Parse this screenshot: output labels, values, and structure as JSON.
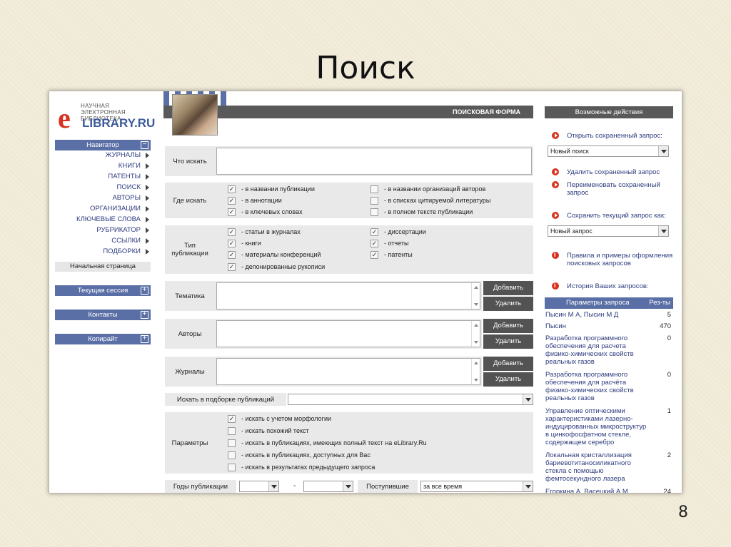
{
  "slide": {
    "title": "Поиск",
    "page_number": "8"
  },
  "logo": {
    "tagline": "НАУЧНАЯ ЭЛЕКТРОННАЯ БИБЛИОТЕКА",
    "letter": "e",
    "name": "LIBRARY.RU"
  },
  "sidebar": {
    "navigator_label": "Навигатор",
    "items": [
      "ЖУРНАЛЫ",
      "КНИГИ",
      "ПАТЕНТЫ",
      "ПОИСК",
      "АВТОРЫ",
      "ОРГАНИЗАЦИИ",
      "КЛЮЧЕВЫЕ СЛОВА",
      "РУБРИКАТОР",
      "ССЫЛКИ",
      "ПОДБОРКИ"
    ],
    "home": "Начальная страница",
    "session": "Текущая сессия",
    "contacts": "Контакты",
    "copyright": "Копирайт"
  },
  "form": {
    "header": "ПОИСКОВАЯ ФОРМА",
    "what_label": "Что искать",
    "where_label": "Где искать",
    "where_options": [
      {
        "label": "- в названии публикации",
        "checked": true
      },
      {
        "label": "- в аннотации",
        "checked": true
      },
      {
        "label": "- в ключевых словах",
        "checked": true
      },
      {
        "label": "- в названии организаций авторов",
        "checked": false
      },
      {
        "label": "- в списках цитируемой литературы",
        "checked": false
      },
      {
        "label": "- в полном тексте публикации",
        "checked": false
      }
    ],
    "type_label": "Тип публикации",
    "type_options": [
      {
        "label": "- статьи в журналах",
        "checked": true
      },
      {
        "label": "- книги",
        "checked": true
      },
      {
        "label": "- материалы конференций",
        "checked": true
      },
      {
        "label": "- депонированные рукописи",
        "checked": true
      },
      {
        "label": "- диссертации",
        "checked": true
      },
      {
        "label": "- отчеты",
        "checked": true
      },
      {
        "label": "- патенты",
        "checked": true
      }
    ],
    "subject_label": "Тематика",
    "authors_label": "Авторы",
    "journals_label": "Журналы",
    "add_label": "Добавить",
    "delete_label": "Удалить",
    "collection_label": "Искать в подборке публикаций",
    "params_label": "Параметры",
    "params_options": [
      {
        "label": "- искать с учетом морфологии",
        "checked": true
      },
      {
        "label": "- искать похожий текст",
        "checked": false
      },
      {
        "label": "- искать в публикациях, имеющих полный текст на eLibrary.Ru",
        "checked": false
      },
      {
        "label": "- искать в публикациях, доступных для Вас",
        "checked": false
      },
      {
        "label": "- искать в результатах предыдущего запроса",
        "checked": false
      }
    ],
    "years_label": "Годы публикации",
    "years_dash": "-",
    "received_label": "Поступившие",
    "received_value": "за все время"
  },
  "actions": {
    "header": "Возможные действия",
    "open_saved": "Открыть сохраненный запрос:",
    "open_select": "Новый поиск",
    "delete_saved": "Удалить сохраненный запрос",
    "rename_saved": "Переименовать сохраненный запрос",
    "save_current": "Сохранить текущий запрос как:",
    "save_select": "Новый запрос",
    "rules": "Правила и примеры оформления поисковых запросов",
    "history": "История Ваших запросов:",
    "history_col1": "Параметры запроса",
    "history_col2": "Рез-ты",
    "history_rows": [
      {
        "query": "Пысин М А, Пысин М Д",
        "count": "5"
      },
      {
        "query": "Пысин",
        "count": "470"
      },
      {
        "query": "Разработка программного обеспечения для расчета физико-химических свойств реальных газов",
        "count": "0"
      },
      {
        "query": "Разработка программного обеспечения для расчёта физико-химических свойств реальных газов",
        "count": "0"
      },
      {
        "query": "Управление оптическими характеристиками лазерно-индуцированных микроструктур в цинкофосфатном стекле, содержащем серебро",
        "count": "1"
      },
      {
        "query": "Локальная кристаллизация бариевотитаносиликатного стекла с помощью фемтосекундного лазера",
        "count": "2"
      },
      {
        "query": "Егоркина А, Васецкий А М",
        "count": "24"
      }
    ]
  }
}
